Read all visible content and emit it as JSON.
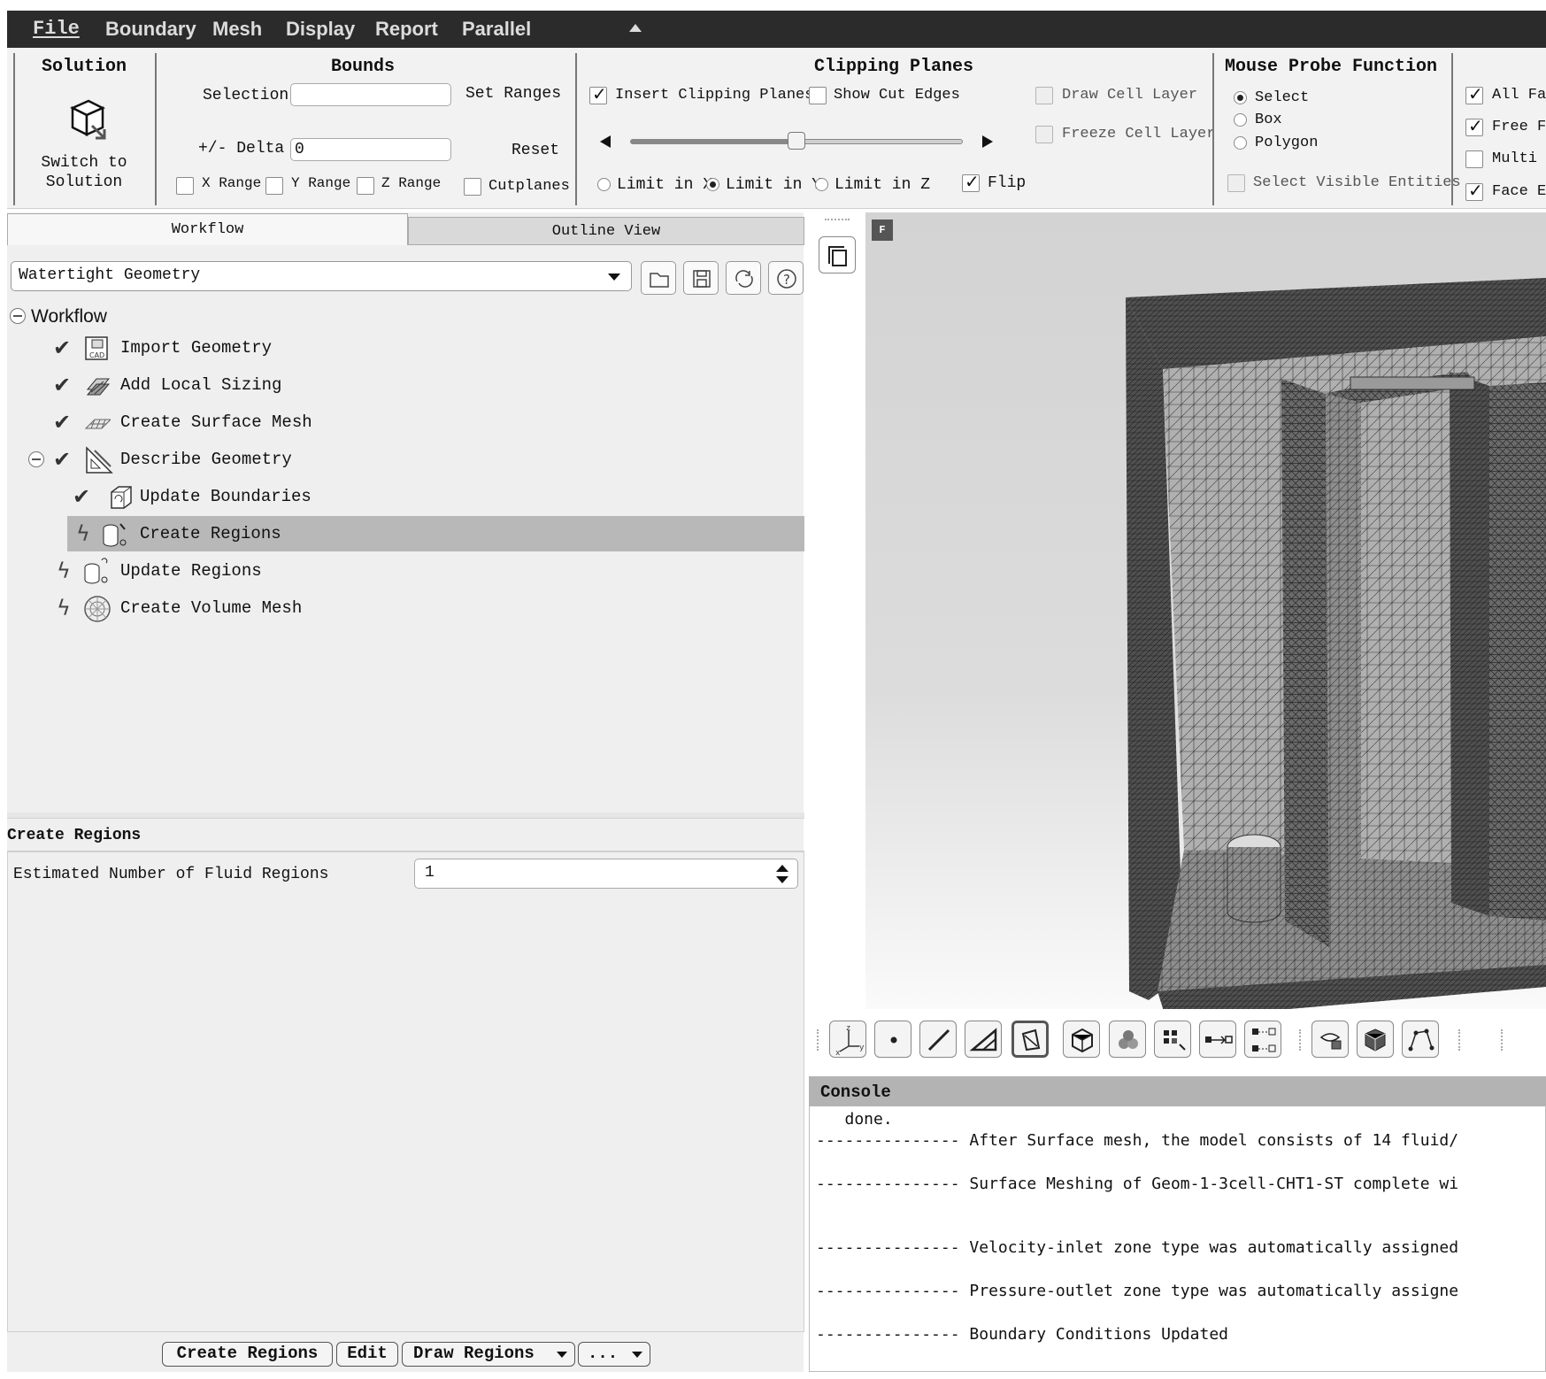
{
  "menu": {
    "items": [
      "File",
      "Boundary",
      "Mesh",
      "Display",
      "Report",
      "Parallel"
    ]
  },
  "ribbon": {
    "solution": {
      "title": "Solution",
      "button_line1": "Switch to",
      "button_line2": "Solution"
    },
    "bounds": {
      "title": "Bounds",
      "selection_label": "Selection",
      "selection_value": "",
      "set_ranges": "Set Ranges",
      "delta_label": "+/- Delta",
      "delta_value": "0",
      "reset": "Reset",
      "x_range": "X Range",
      "y_range": "Y Range",
      "z_range": "Z Range",
      "cutplanes": "Cutplanes"
    },
    "clipping": {
      "title": "Clipping Planes",
      "insert": "Insert Clipping Planes",
      "show_cut_edges": "Show Cut Edges",
      "draw_cell_layer": "Draw Cell Layer",
      "freeze_cell_layer": "Freeze Cell Layer",
      "limit_x": "Limit in X",
      "limit_y": "Limit in Y",
      "limit_z": "Limit in Z",
      "flip": "Flip",
      "slider_fraction": 0.5
    },
    "probe": {
      "title": "Mouse Probe Function",
      "select": "Select",
      "box": "Box",
      "polygon": "Polygon",
      "select_visible": "Select Visible Entities"
    },
    "faces": {
      "all_faces": "All Fa",
      "free_faces": "Free F",
      "multi": "Multi",
      "face_edges": "Face E"
    }
  },
  "left": {
    "tabs": [
      "Workflow",
      "Outline View"
    ],
    "workflow_select": "Watertight Geometry",
    "tree_root": "Workflow",
    "tasks": [
      "Import Geometry",
      "Add Local Sizing",
      "Create Surface Mesh",
      "Describe Geometry",
      "Update Boundaries",
      "Create Regions",
      "Update Regions",
      "Create Volume Mesh"
    ],
    "task_panel_title": "Create Regions",
    "field_label": "Estimated Number of Fluid Regions",
    "field_value": "1",
    "buttons": {
      "create": "Create Regions",
      "edit": "Edit",
      "draw": "Draw Regions",
      "more": "..."
    }
  },
  "console": {
    "title": "Console",
    "lines": [
      "   done.",
      "--------------- After Surface mesh, the model consists of 14 fluid/",
      "--------------- Surface Meshing of Geom-1-3cell-CHT1-ST complete wi",
      "--------------- Velocity-inlet zone type was automatically assigned",
      "--------------- Pressure-outlet zone type was automatically assigne",
      "--------------- Boundary Conditions Updated"
    ]
  },
  "viewport": {
    "badge": "F"
  }
}
